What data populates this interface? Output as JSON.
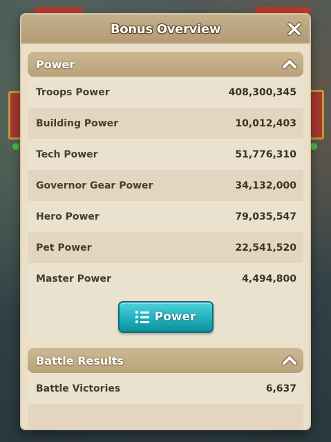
{
  "dialog": {
    "title": "Bonus Overview",
    "close_icon": "close-x-icon"
  },
  "power_section": {
    "title": "Power",
    "collapse_icon": "chevron-up-icon",
    "rows": [
      {
        "label": "Troops Power",
        "value": "408,300,345"
      },
      {
        "label": "Building Power",
        "value": "10,012,403"
      },
      {
        "label": "Tech Power",
        "value": "51,776,310"
      },
      {
        "label": "Governor Gear Power",
        "value": "34,132,000"
      },
      {
        "label": "Hero Power",
        "value": "79,035,547"
      },
      {
        "label": "Pet Power",
        "value": "22,541,520"
      },
      {
        "label": "Master Power",
        "value": "4,494,800"
      }
    ],
    "button_label": "Power",
    "button_icon": "list-icon"
  },
  "battle_section": {
    "title": "Battle Results",
    "collapse_icon": "chevron-up-icon",
    "rows": [
      {
        "label": "Battle Victories",
        "value": "6,637"
      }
    ]
  },
  "colors": {
    "panel": "#eadfc9",
    "header": "#b29a73",
    "button": "#1fb1bd",
    "text": "#4a3c2b"
  }
}
